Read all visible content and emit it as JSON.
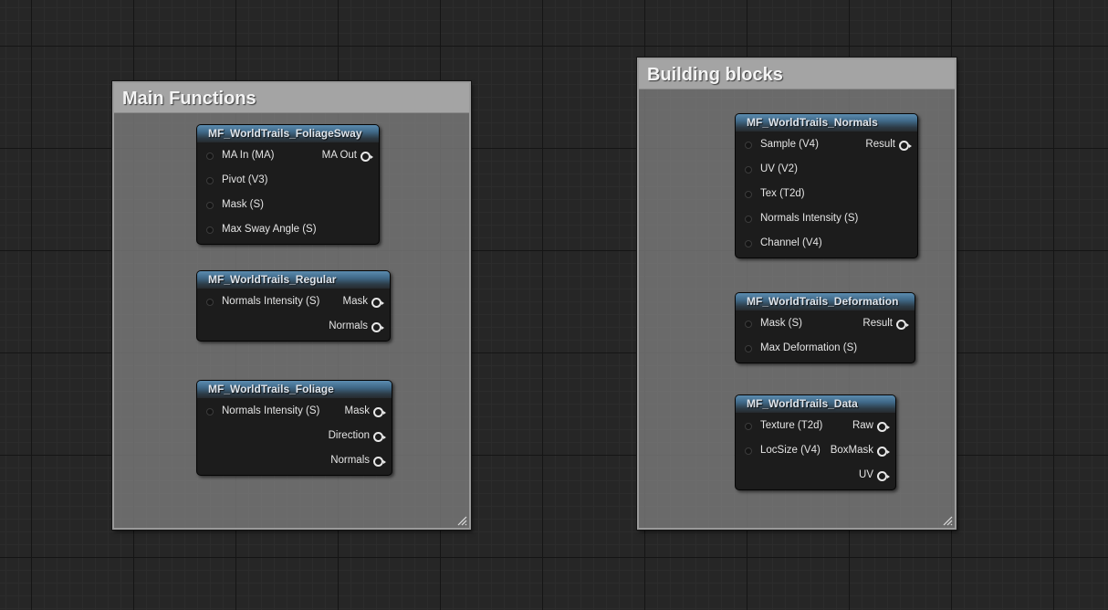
{
  "comments": [
    {
      "title": "Main Functions",
      "nodes": [
        {
          "title": "MF_WorldTrails_FoliageSway",
          "rows": [
            {
              "in": "MA In (MA)",
              "out": "MA Out"
            },
            {
              "in": "Pivot (V3)",
              "out": ""
            },
            {
              "in": "Mask (S)",
              "out": ""
            },
            {
              "in": "Max Sway Angle (S)",
              "out": ""
            }
          ]
        },
        {
          "title": "MF_WorldTrails_Regular",
          "rows": [
            {
              "in": "Normals Intensity (S)",
              "out": "Mask"
            },
            {
              "in": "",
              "out": "Normals"
            }
          ]
        },
        {
          "title": "MF_WorldTrails_Foliage",
          "rows": [
            {
              "in": "Normals Intensity (S)",
              "out": "Mask"
            },
            {
              "in": "",
              "out": "Direction"
            },
            {
              "in": "",
              "out": "Normals"
            }
          ]
        }
      ]
    },
    {
      "title": "Building blocks",
      "nodes": [
        {
          "title": "MF_WorldTrails_Normals",
          "rows": [
            {
              "in": "Sample (V4)",
              "out": "Result"
            },
            {
              "in": "UV (V2)",
              "out": ""
            },
            {
              "in": "Tex (T2d)",
              "out": ""
            },
            {
              "in": "Normals Intensity (S)",
              "out": ""
            },
            {
              "in": "Channel (V4)",
              "out": ""
            }
          ]
        },
        {
          "title": "MF_WorldTrails_Deformation",
          "rows": [
            {
              "in": "Mask (S)",
              "out": "Result"
            },
            {
              "in": "Max Deformation (S)",
              "out": ""
            }
          ]
        },
        {
          "title": "MF_WorldTrails_Data",
          "rows": [
            {
              "in": "Texture (T2d)",
              "out": "Raw"
            },
            {
              "in": "LocSize (V4)",
              "out": "BoxMask"
            },
            {
              "in": "",
              "out": "UV"
            }
          ]
        }
      ]
    }
  ]
}
